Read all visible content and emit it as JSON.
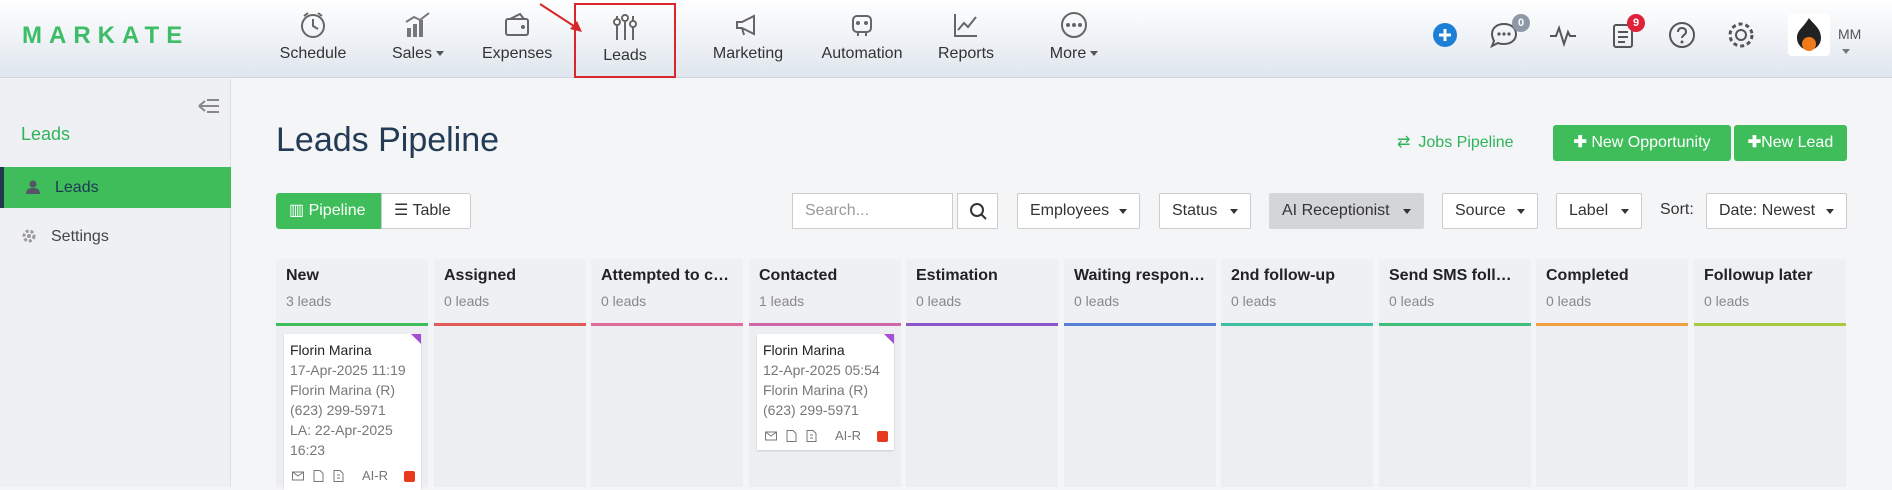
{
  "app": {
    "logo": "MARKATE"
  },
  "nav": [
    {
      "label": "Schedule",
      "icon": "clock-icon"
    },
    {
      "label": "Sales",
      "icon": "sales-chart-icon",
      "caret": true
    },
    {
      "label": "Expenses",
      "icon": "wallet-icon"
    },
    {
      "label": "Leads",
      "icon": "sliders-icon",
      "active": true
    },
    {
      "label": "Marketing",
      "icon": "megaphone-icon"
    },
    {
      "label": "Automation",
      "icon": "robot-icon"
    },
    {
      "label": "Reports",
      "icon": "line-chart-icon"
    },
    {
      "label": "More",
      "icon": "dots-circle-icon",
      "caret": true
    }
  ],
  "header_right": {
    "messages_badge": "0",
    "tasks_badge": "9",
    "user_initials": "MM"
  },
  "sidebar": {
    "title": "Leads",
    "items": [
      {
        "label": "Leads",
        "icon": "user-icon",
        "active": true
      },
      {
        "label": "Settings",
        "icon": "gear-icon"
      }
    ]
  },
  "main": {
    "title": "Leads Pipeline",
    "jobs_pipeline": "Jobs Pipeline",
    "new_opportunity": "New Opportunity",
    "new_lead": "New Lead",
    "view_pipeline": "Pipeline",
    "view_table": "Table",
    "search_placeholder": "Search...",
    "filters": {
      "employees": "Employees",
      "status": "Status",
      "ai": "AI Receptionist",
      "source": "Source",
      "label": "Label"
    },
    "sort_label": "Sort:",
    "sort_value": "Date: Newest"
  },
  "columns": [
    {
      "name": "New",
      "count": "3 leads",
      "color": "#3fbd5a"
    },
    {
      "name": "Assigned",
      "count": "0 leads",
      "color": "#e05a5a"
    },
    {
      "name": "Attempted to contact",
      "count": "0 leads",
      "color": "#e06a9a"
    },
    {
      "name": "Contacted",
      "count": "1 leads",
      "color": "#d067a8"
    },
    {
      "name": "Estimation",
      "count": "0 leads",
      "color": "#8b57c9"
    },
    {
      "name": "Waiting response",
      "count": "0 leads",
      "color": "#5a7fd6"
    },
    {
      "name": "2nd follow-up",
      "count": "0 leads",
      "color": "#3fbfa0"
    },
    {
      "name": "Send SMS follow-up",
      "count": "0 leads",
      "color": "#3fbd7a"
    },
    {
      "name": "Completed",
      "count": "0 leads",
      "color": "#f0a040"
    },
    {
      "name": "Followup later",
      "count": "0 leads",
      "color": "#a8c83c"
    }
  ],
  "cards": {
    "new": {
      "name": "Florin Marina",
      "date": "17-Apr-2025 11:19",
      "contact": "Florin Marina (R)",
      "phone": "(623) 299-5971",
      "la": "LA: 22-Apr-2025 16:23",
      "tag": "AI-R"
    },
    "contacted": {
      "name": "Florin Marina",
      "date": "12-Apr-2025 05:54",
      "contact": "Florin Marina (R)",
      "phone": "(623) 299-5971",
      "tag": "AI-R"
    }
  }
}
